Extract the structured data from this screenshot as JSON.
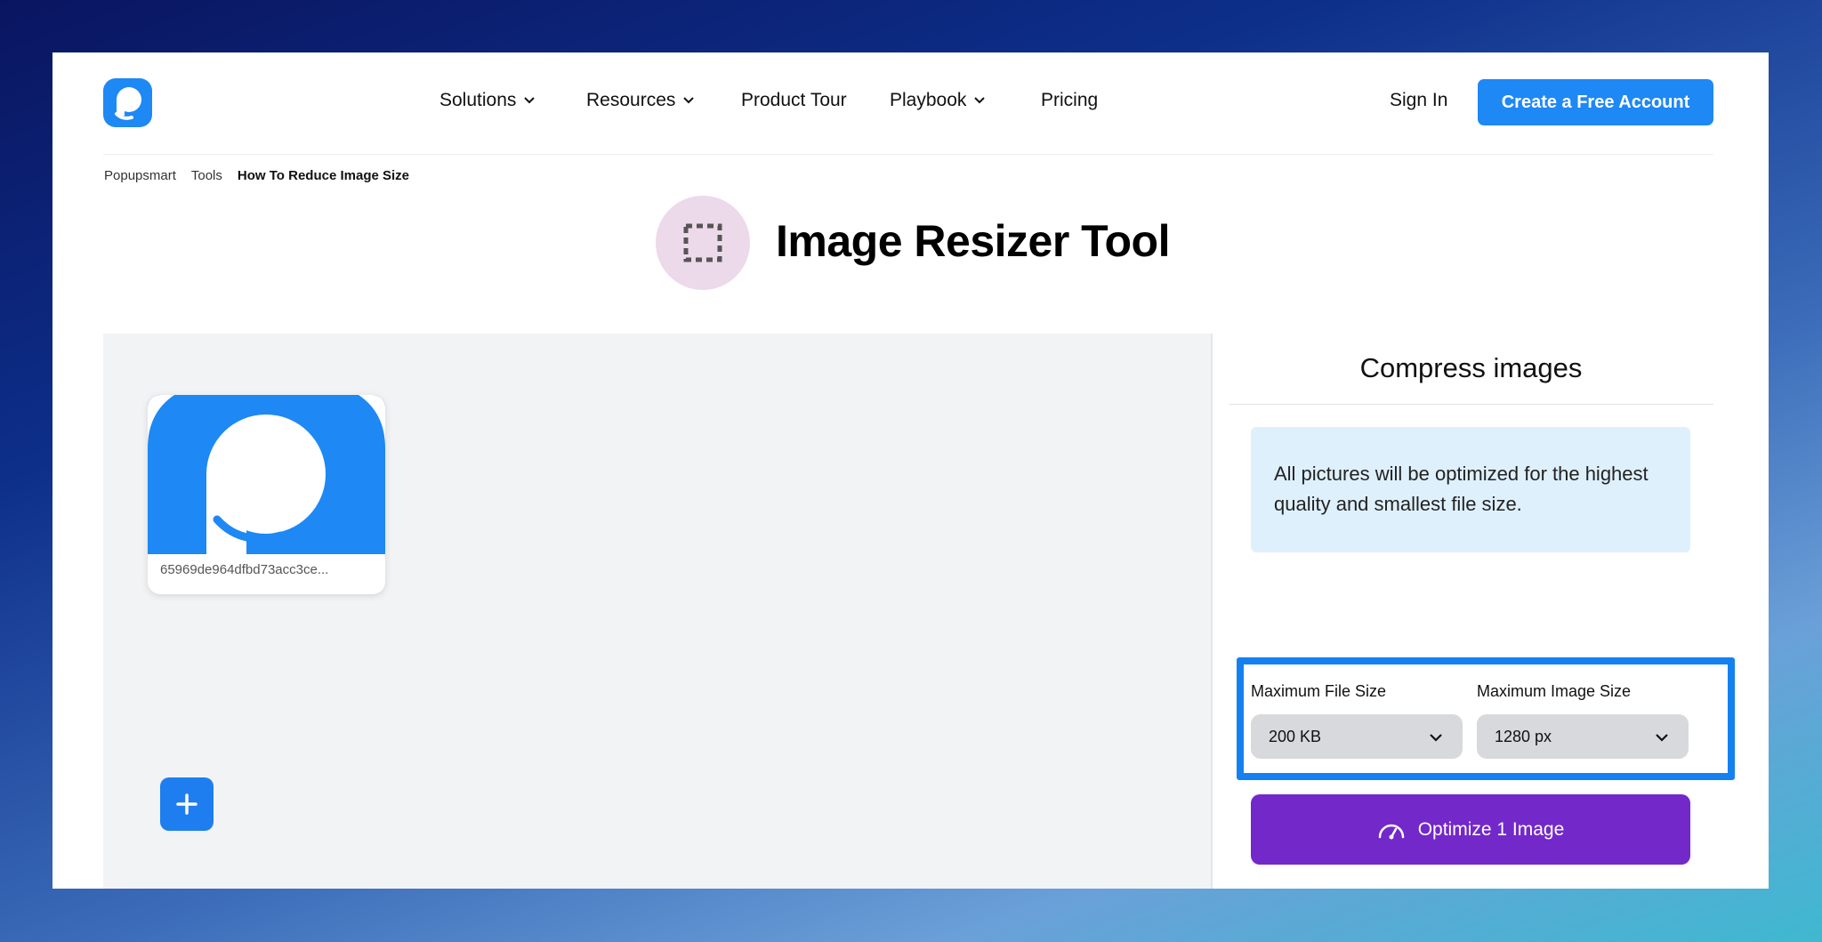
{
  "header": {
    "nav": [
      {
        "label": "Solutions",
        "has_dropdown": true
      },
      {
        "label": "Resources",
        "has_dropdown": true
      },
      {
        "label": "Product Tour",
        "has_dropdown": false
      },
      {
        "label": "Playbook",
        "has_dropdown": true
      },
      {
        "label": "Pricing",
        "has_dropdown": false
      }
    ],
    "signin_label": "Sign In",
    "cta_label": "Create a Free Account"
  },
  "breadcrumb": [
    "Popupsmart",
    "Tools",
    "How To Reduce Image Size"
  ],
  "page_title": "Image Resizer Tool",
  "upload": {
    "file_name": "65969de964dfbd73acc3ce..."
  },
  "panel": {
    "title": "Compress images",
    "info": "All pictures will be optimized for the highest quality and smallest file size.",
    "max_file_size_label": "Maximum File Size",
    "max_file_size_value": "200 KB",
    "max_image_size_label": "Maximum Image Size",
    "max_image_size_value": "1280 px",
    "optimize_label": "Optimize 1 Image"
  },
  "colors": {
    "brand_blue": "#1e88f5",
    "optimize_purple": "#7328ca",
    "highlight_border": "#1581f0",
    "info_bg": "#dff0fd"
  }
}
